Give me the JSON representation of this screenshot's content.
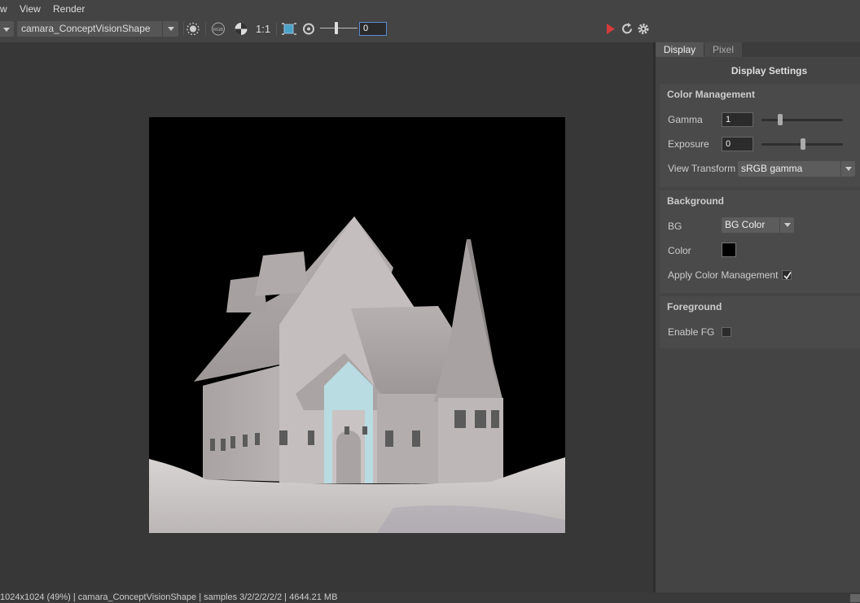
{
  "menubar": {
    "items": [
      "w",
      "View",
      "Render"
    ]
  },
  "toolbar": {
    "camera": "camara_ConceptVisionShape",
    "ratio_label": "1:1",
    "rgb_label": "RGB",
    "frame_value": "0",
    "icons": [
      "region-icon",
      "rgb-icon",
      "alpha-icon",
      "frame-region-icon",
      "snapshot-icon",
      "render-play-icon",
      "refresh-icon",
      "gear-icon"
    ],
    "colors": {
      "play": "#d63b3b",
      "accent": "#5a8ad0"
    }
  },
  "tabs": [
    {
      "label": "Display",
      "active": true
    },
    {
      "label": "Pixel",
      "active": false
    }
  ],
  "panel": {
    "title": "Display Settings",
    "color_management": {
      "header": "Color Management",
      "gamma_label": "Gamma",
      "gamma_value": "1",
      "exposure_label": "Exposure",
      "exposure_value": "0",
      "view_transform_label": "View Transform",
      "view_transform_value": "sRGB gamma"
    },
    "background": {
      "header": "Background",
      "bg_label": "BG",
      "bg_value": "BG Color",
      "color_label": "Color",
      "color_value": "#000000",
      "apply_cm_label": "Apply Color Management",
      "apply_cm_checked": true
    },
    "foreground": {
      "header": "Foreground",
      "enable_fg_label": "Enable FG",
      "enable_fg_checked": false
    }
  },
  "status": {
    "text": "1024x1024 (49%) | camara_ConceptVisionShape  | samples 3/2/2/2/2/2 | 4644.21 MB"
  }
}
